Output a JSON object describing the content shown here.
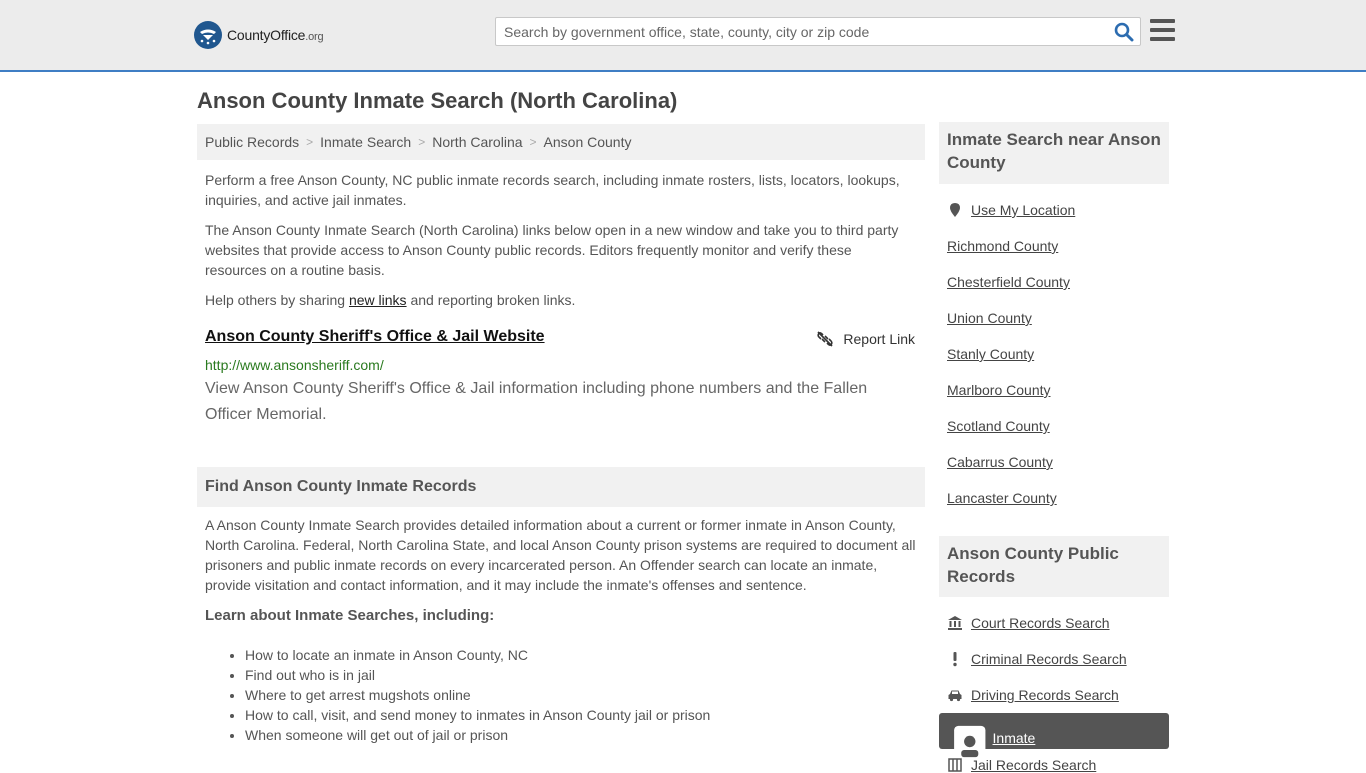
{
  "header": {
    "logo_main": "CountyOffice",
    "logo_suffix": ".org",
    "search_placeholder": "Search by government office, state, county, city or zip code"
  },
  "page_title": "Anson County Inmate Search (North Carolina)",
  "breadcrumb": [
    "Public Records",
    "Inmate Search",
    "North Carolina",
    "Anson County"
  ],
  "intro": {
    "p1": "Perform a free Anson County, NC public inmate records search, including inmate rosters, lists, locators, lookups, inquiries, and active jail inmates.",
    "p2": "The Anson County Inmate Search (North Carolina) links below open in a new window and take you to third party websites that provide access to Anson County public records. Editors frequently monitor and verify these resources on a routine basis.",
    "p3_before": "Help others by sharing ",
    "p3_link": "new links",
    "p3_after": " and reporting broken links."
  },
  "result": {
    "title": "Anson County Sheriff's Office & Jail Website",
    "report_label": "Report Link",
    "url": "http://www.ansonsheriff.com/",
    "description": "View Anson County Sheriff's Office & Jail information including phone numbers and the Fallen Officer Memorial."
  },
  "find_section": {
    "heading": "Find Anson County Inmate Records",
    "body": "A Anson County Inmate Search provides detailed information about a current or former inmate in Anson County, North Carolina. Federal, North Carolina State, and local Anson County prison systems are required to document all prisoners and public inmate records on every incarcerated person. An Offender search can locate an inmate, provide visitation and contact information, and it may include the inmate's offenses and sentence.",
    "learn_heading": "Learn about Inmate Searches, including:",
    "bullets": [
      "How to locate an inmate in Anson County, NC",
      "Find out who is in jail",
      "Where to get arrest mugshots online",
      "How to call, visit, and send money to inmates in Anson County jail or prison",
      "When someone will get out of jail or prison"
    ]
  },
  "sidebar": {
    "nearby_heading": "Inmate Search near Anson County",
    "use_location": "Use My Location",
    "nearby": [
      "Richmond County",
      "Chesterfield County",
      "Union County",
      "Stanly County",
      "Marlboro County",
      "Scotland County",
      "Cabarrus County",
      "Lancaster County"
    ],
    "records_heading": "Anson County Public Records",
    "records": [
      {
        "label": "Court Records Search",
        "icon": "courthouse-icon"
      },
      {
        "label": "Criminal Records Search",
        "icon": "exclamation-icon"
      },
      {
        "label": "Driving Records Search",
        "icon": "car-icon"
      },
      {
        "label": "Inmate Search",
        "icon": "id-badge-icon"
      },
      {
        "label": "Jail Records Search",
        "icon": "jail-icon"
      }
    ]
  }
}
